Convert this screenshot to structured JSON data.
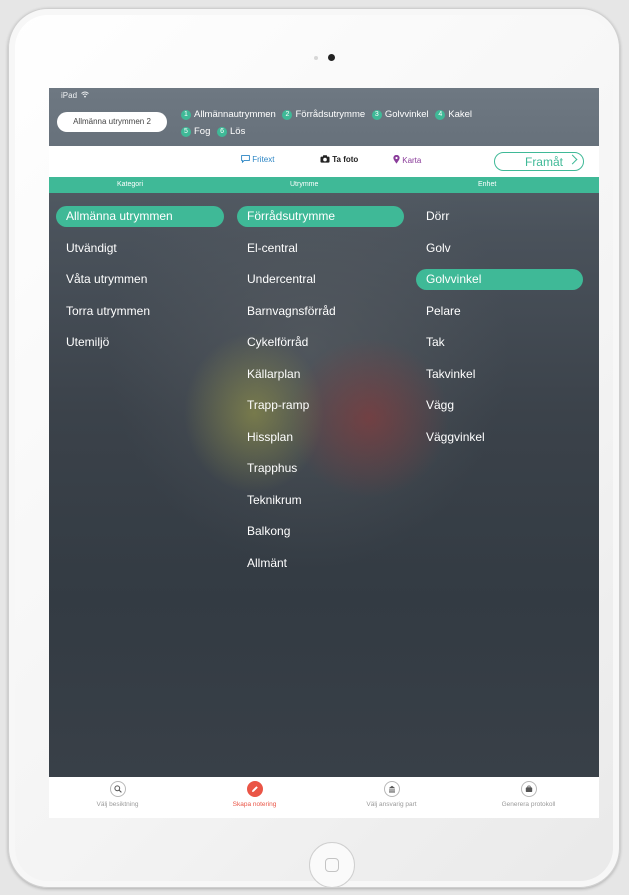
{
  "status": {
    "device": "iPad"
  },
  "breadcrumb": {
    "current": "Allmänna utrymmen 2",
    "steps": [
      {
        "num": "1",
        "label": "Allmännautrymmen"
      },
      {
        "num": "2",
        "label": "Förrådsutrymme"
      },
      {
        "num": "3",
        "label": "Golvvinkel"
      },
      {
        "num": "4",
        "label": "Kakel"
      },
      {
        "num": "5",
        "label": "Fog"
      },
      {
        "num": "6",
        "label": "Lös"
      }
    ]
  },
  "toolbar": {
    "fritext": "Fritext",
    "ta_foto": "Ta foto",
    "karta": "Karta",
    "forward": "Framåt"
  },
  "columns": {
    "kategori": {
      "header": "Kategori",
      "items": [
        "Allmänna utrymmen",
        "Utvändigt",
        "Våta utrymmen",
        "Torra utrymmen",
        "Utemiljö"
      ],
      "selected": "Allmänna utrymmen"
    },
    "utrymme": {
      "header": "Utrymme",
      "items": [
        "Förrådsutrymme",
        "El-central",
        "Undercentral",
        "Barnvagnsförråd",
        "Cykelförråd",
        "Källarplan",
        "Trapp-ramp",
        "Hissplan",
        "Trapphus",
        "Teknikrum",
        "Balkong",
        "Allmänt"
      ],
      "selected": "Förrådsutrymme"
    },
    "enhet": {
      "header": "Enhet",
      "items": [
        "Dörr",
        "Golv",
        "Golvvinkel",
        "Pelare",
        "Tak",
        "Takvinkel",
        "Vägg",
        "Väggvinkel"
      ],
      "selected": "Golvvinkel"
    }
  },
  "bottom_nav": [
    {
      "label": "Välj besiktning",
      "icon": "search-icon",
      "active": false
    },
    {
      "label": "Skapa notering",
      "icon": "pencil-icon",
      "active": true
    },
    {
      "label": "Välj ansvarig part",
      "icon": "building-icon",
      "active": false
    },
    {
      "label": "Generera protokoll",
      "icon": "briefcase-icon",
      "active": false
    }
  ],
  "colors": {
    "accent": "#3fb997",
    "active_nav": "#ea5546"
  }
}
